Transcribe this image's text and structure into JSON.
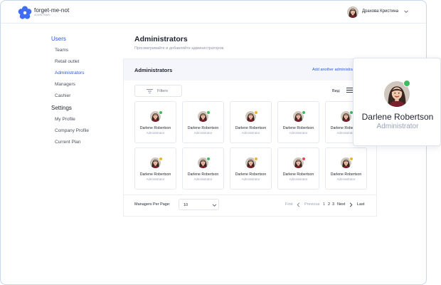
{
  "app": {
    "brand": "forget-me-not",
    "brand_sub": "ADMIN PANEL",
    "logo_color": "#3f6ff0"
  },
  "topbar": {
    "user_name": "Драхова Кристина"
  },
  "sidebar": {
    "sections": [
      {
        "title": "Users",
        "active": true,
        "items": [
          {
            "label": "Teams"
          },
          {
            "label": "Retail outlet"
          },
          {
            "label": "Administrators",
            "active": true
          },
          {
            "label": "Managers"
          },
          {
            "label": "Cashier"
          }
        ]
      },
      {
        "title": "Settings",
        "active": false,
        "items": [
          {
            "label": "My Profile"
          },
          {
            "label": "Company Profile"
          },
          {
            "label": "Current Plan"
          }
        ]
      }
    ]
  },
  "page": {
    "title": "Administrators",
    "subtitle": "Просматривайте и добавляйте администраторов"
  },
  "panel": {
    "title": "Administrators",
    "add_link": "Add another administrator",
    "filters_label": "Filters",
    "view_label": "Вид:"
  },
  "cards": [
    {
      "name": "Darlene Robertson",
      "role": "Administrator",
      "status": "#3dbb5f"
    },
    {
      "name": "Darlene Robertson",
      "role": "Administrator",
      "status": "#3dbb5f"
    },
    {
      "name": "Darlene Robertson",
      "role": "Administrator",
      "status": "#f0b429"
    },
    {
      "name": "Darlene Robertson",
      "role": "Administrator",
      "status": "#3dbb5f"
    },
    {
      "name": "Darlene Robertson",
      "role": "Administrator",
      "status": "#3dbb5f"
    },
    {
      "name": "Darlene Robertson",
      "role": "Administrator",
      "status": "#f0b429"
    },
    {
      "name": "Darlene Robertson",
      "role": "Administrator",
      "status": "#3dbb5f"
    },
    {
      "name": "Darlene Robertson",
      "role": "Administrator",
      "status": "#f0b429"
    },
    {
      "name": "Darlene Robertson",
      "role": "Administrator",
      "status": "#e5484d"
    },
    {
      "name": "Darlene Robertson",
      "role": "Administrator",
      "status": "#f0b429"
    }
  ],
  "footer": {
    "per_page_label": "Managers Per Page:",
    "per_page_value": "10",
    "pagination": {
      "first": "First",
      "previous": "Previous",
      "pages": [
        "1",
        "2",
        "3"
      ],
      "current": "1",
      "next": "Next",
      "last": "Last"
    }
  },
  "popover": {
    "name": "Darlene Robertson",
    "role": "Administrator",
    "status": "#3dbb5f"
  },
  "colors": {
    "accent": "#2b58d6",
    "online": "#3dbb5f",
    "away": "#f0b429",
    "busy": "#e5484d"
  }
}
